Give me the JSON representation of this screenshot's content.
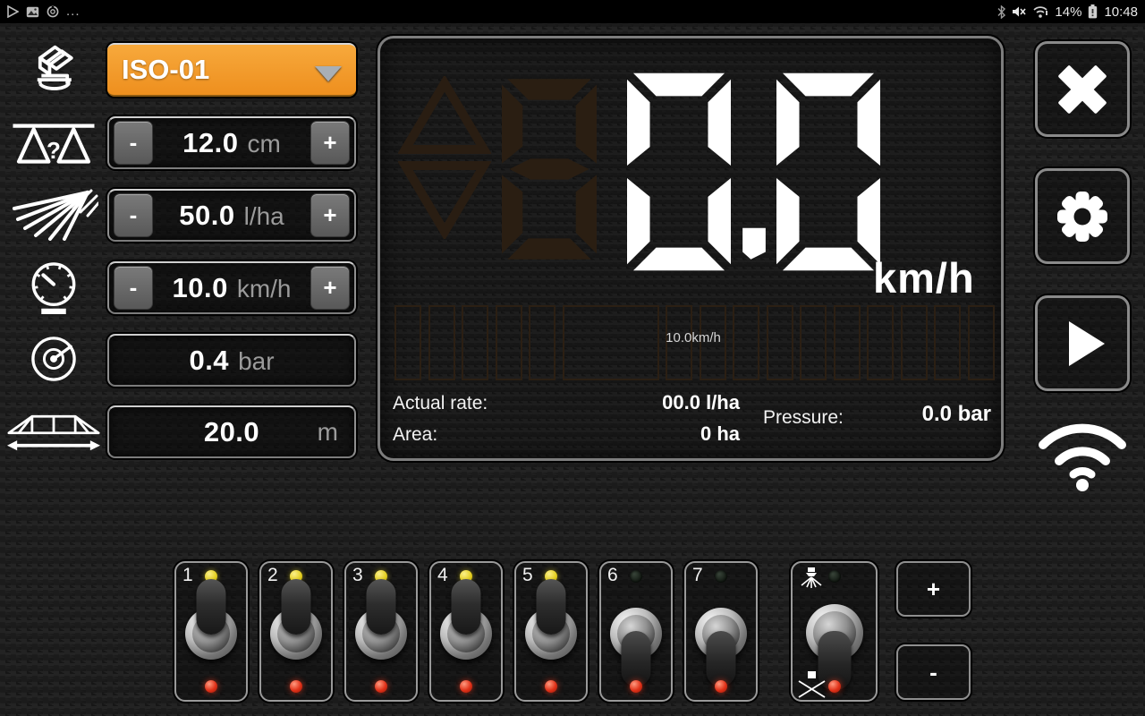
{
  "status_bar": {
    "left_icons": [
      "play-store-icon",
      "gallery-icon",
      "data-usage-icon",
      "more-icon"
    ],
    "right_icons": [
      "bluetooth-icon",
      "mute-icon",
      "wifi-status-icon",
      "battery-icon"
    ],
    "battery_percent": "14%",
    "time": "10:48"
  },
  "profile": {
    "value": "ISO-01"
  },
  "steppers": {
    "minus": "-",
    "plus": "+"
  },
  "fields": [
    {
      "name": "nozzle-spacing",
      "icon": "nozzle-spacing-icon",
      "value": "12.0",
      "unit": "cm",
      "has_steppers": true
    },
    {
      "name": "application-rate",
      "icon": "application-rate-icon",
      "value": "50.0",
      "unit": "l/ha",
      "has_steppers": true
    },
    {
      "name": "target-speed",
      "icon": "speedometer-icon",
      "value": "10.0",
      "unit": "km/h",
      "has_steppers": true
    },
    {
      "name": "pressure",
      "icon": "pressure-gauge-icon",
      "value": "0.4",
      "unit": "bar",
      "has_steppers": false
    },
    {
      "name": "working-width",
      "icon": "boom-width-icon",
      "value": "20.0",
      "unit": "m",
      "has_steppers": false
    }
  ],
  "display": {
    "speed_value": "0.0",
    "speed_unit": "km/h",
    "target_speed_note": "10.0km/h",
    "actual_rate_label": "Actual rate:",
    "actual_rate_value": "00.0 l/ha",
    "area_label": "Area:",
    "area_value": "0 ha",
    "pressure_label": "Pressure:",
    "pressure_value": "0.0 bar"
  },
  "action_buttons": [
    {
      "name": "close-button",
      "icon": "close-icon"
    },
    {
      "name": "settings-button",
      "icon": "gear-icon"
    },
    {
      "name": "start-button",
      "icon": "play-icon"
    },
    {
      "name": "wifi-button",
      "icon": "wifi-icon"
    }
  ],
  "switches": [
    {
      "label": "1",
      "master": false,
      "position": "up",
      "top_led": "yellow",
      "bottom_led": "red"
    },
    {
      "label": "2",
      "master": false,
      "position": "up",
      "top_led": "yellow",
      "bottom_led": "red"
    },
    {
      "label": "3",
      "master": false,
      "position": "up",
      "top_led": "yellow",
      "bottom_led": "red"
    },
    {
      "label": "4",
      "master": false,
      "position": "up",
      "top_led": "yellow",
      "bottom_led": "red"
    },
    {
      "label": "5",
      "master": false,
      "position": "up",
      "top_led": "yellow",
      "bottom_led": "red"
    },
    {
      "label": "6",
      "master": false,
      "position": "down",
      "top_led": "off",
      "bottom_led": "red"
    },
    {
      "label": "7",
      "master": false,
      "position": "down",
      "top_led": "off",
      "bottom_led": "red"
    },
    {
      "label": "",
      "master": true,
      "position": "down",
      "top_led": "off",
      "bottom_led": "red"
    }
  ],
  "switch_steppers": {
    "plus": "+",
    "minus": "-"
  },
  "colors": {
    "accent_orange": "#f09a26",
    "led_yellow": "#e6d41f",
    "led_red": "#e23018",
    "digit_white": "#ffffff",
    "ghost_segment": "#2a1e12"
  }
}
